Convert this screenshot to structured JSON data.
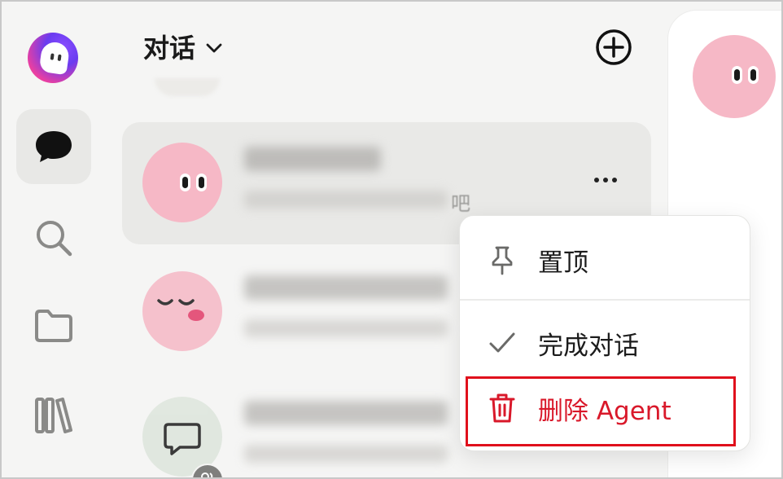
{
  "header": {
    "title": "对话"
  },
  "conversations": [
    {
      "name_blurred": true,
      "message_tail": "吧",
      "avatar": "pink-blob-open-eyes"
    },
    {
      "name_blurred": true,
      "message_tail": "",
      "avatar": "pink-blob-sleepy"
    },
    {
      "name_blurred": true,
      "message_tail": "",
      "avatar": "chat-bubble-group"
    }
  ],
  "context_menu": {
    "items": [
      {
        "label": "置顶",
        "icon": "pin-icon"
      },
      {
        "label": "完成对话",
        "icon": "check-icon"
      },
      {
        "label": "删除 Agent",
        "icon": "trash-icon"
      }
    ]
  },
  "colors": {
    "danger": "#d9182a",
    "highlight_border": "#e0101c",
    "avatar_pink": "#f6b8c6",
    "selected_row": "#e9e9e7"
  }
}
